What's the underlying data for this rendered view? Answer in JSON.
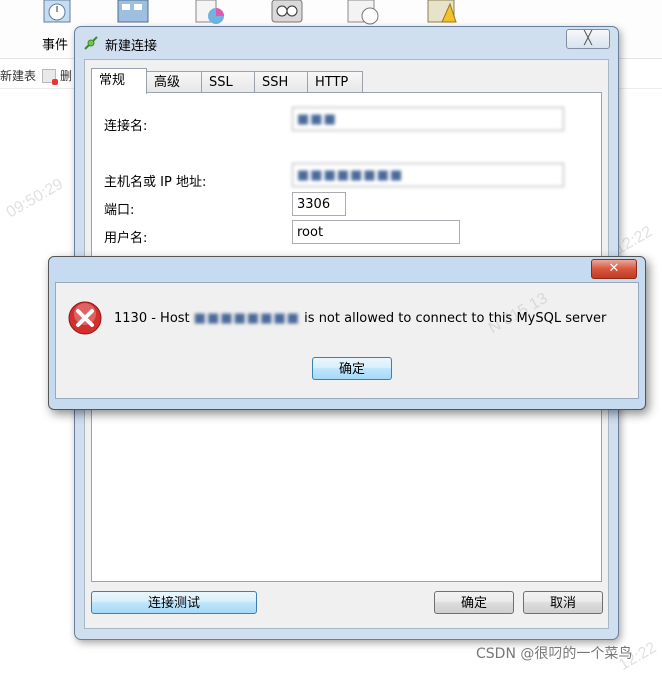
{
  "toolbar": {
    "event_label": "事件"
  },
  "subbar": {
    "new_table": "新建表",
    "delete_partial": "删"
  },
  "watermarks": {
    "left_time": "09:50:29",
    "right_time": "12:22",
    "mid_text": "N 015 13",
    "bottom_time": "12:22"
  },
  "dialog": {
    "title": "新建连接",
    "close_glyph": "╳",
    "tabs": [
      {
        "label": "常规"
      },
      {
        "label": "高级"
      },
      {
        "label": "SSL"
      },
      {
        "label": "SSH"
      },
      {
        "label": "HTTP"
      }
    ],
    "fields": {
      "connection_name": {
        "label": "连接名:",
        "value": "■■■"
      },
      "host": {
        "label": "主机名或 IP 地址:",
        "value": "■■■■■■■■"
      },
      "port": {
        "label": "端口:",
        "value": "3306"
      },
      "username": {
        "label": "用户名:",
        "value": "root"
      }
    },
    "buttons": {
      "test_connection": "连接测试",
      "ok": "确定",
      "cancel": "取消"
    }
  },
  "error_dialog": {
    "close_glyph": "✕",
    "message_prefix": "1130 - Host ",
    "message_host_redacted": "■■■■■■■■",
    "message_suffix": " is not allowed to connect to this MySQL server",
    "ok_button": "确定"
  },
  "footer": {
    "csdn": "CSDN @很叼的一个菜鸟"
  },
  "colors": {
    "dialog_frame": "#cfdff0",
    "error_icon": "#d32f2f",
    "primary_button": "#bee6fd"
  }
}
